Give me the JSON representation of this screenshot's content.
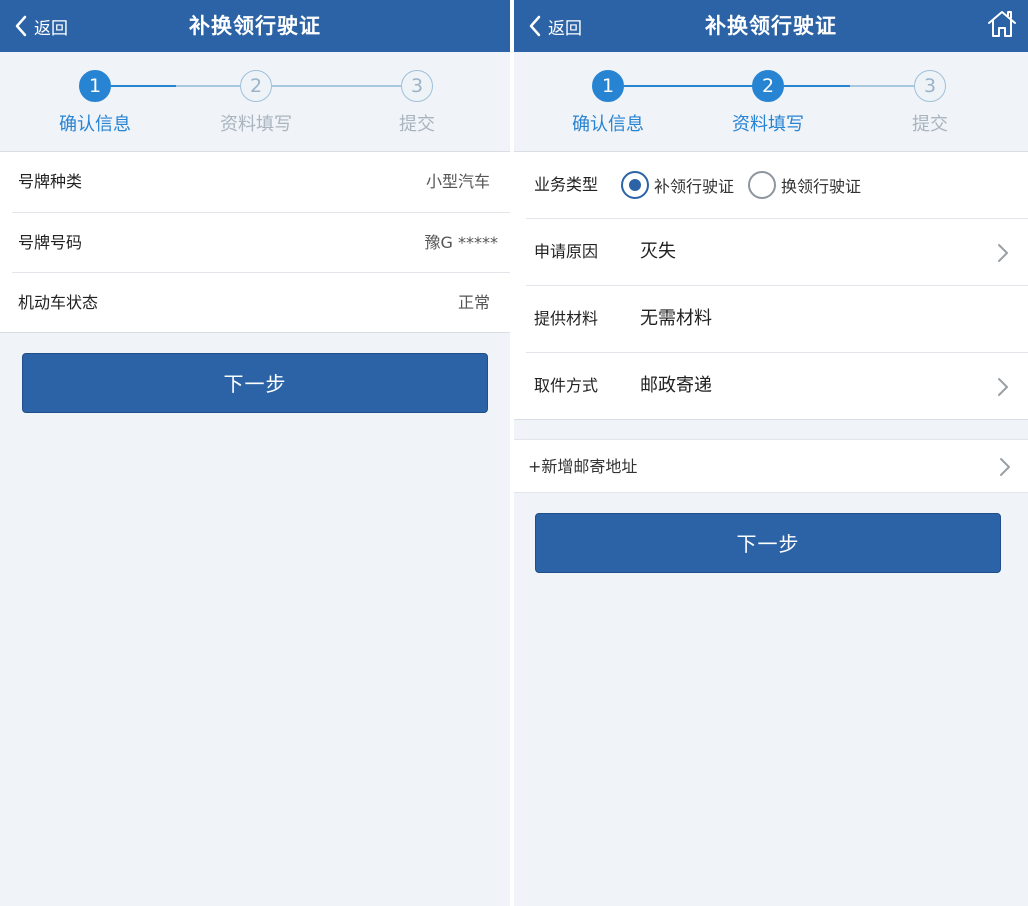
{
  "colors": {
    "header_bg": "#2b63a6",
    "step_active": "#2784d3",
    "step_inactive": "#9fc0d8",
    "page_bg": "#f0f3f8",
    "button_bg": "#2b63a6"
  },
  "left": {
    "header": {
      "back_label": "返回",
      "title": "补换领行驶证",
      "back_icon": "chevron-left-icon"
    },
    "steps": [
      {
        "num": "1",
        "label": "确认信息",
        "state": "active"
      },
      {
        "num": "2",
        "label": "资料填写",
        "state": "inactive"
      },
      {
        "num": "3",
        "label": "提交",
        "state": "inactive"
      }
    ],
    "rows": [
      {
        "key": "号牌种类",
        "value": "小型汽车"
      },
      {
        "key": "号牌号码",
        "value": "豫G *****"
      },
      {
        "key": "机动车状态",
        "value": "正常"
      }
    ],
    "next_label": "下一步"
  },
  "right": {
    "header": {
      "back_label": "返回",
      "title": "补换领行驶证",
      "back_icon": "chevron-left-icon",
      "home_icon": "home-icon"
    },
    "steps": [
      {
        "num": "1",
        "label": "确认信息",
        "state": "active"
      },
      {
        "num": "2",
        "label": "资料填写",
        "state": "active"
      },
      {
        "num": "3",
        "label": "提交",
        "state": "inactive"
      }
    ],
    "business_type": {
      "key": "业务类型",
      "options": [
        {
          "label": "补领行驶证",
          "checked": true
        },
        {
          "label": "换领行驶证",
          "checked": false
        }
      ]
    },
    "reason": {
      "key": "申请原因",
      "value": "灭失"
    },
    "materials": {
      "key": "提供材料",
      "value": "无需材料"
    },
    "pickup": {
      "key": "取件方式",
      "value": "邮政寄递"
    },
    "add_address": "+新增邮寄地址",
    "next_label": "下一步"
  }
}
